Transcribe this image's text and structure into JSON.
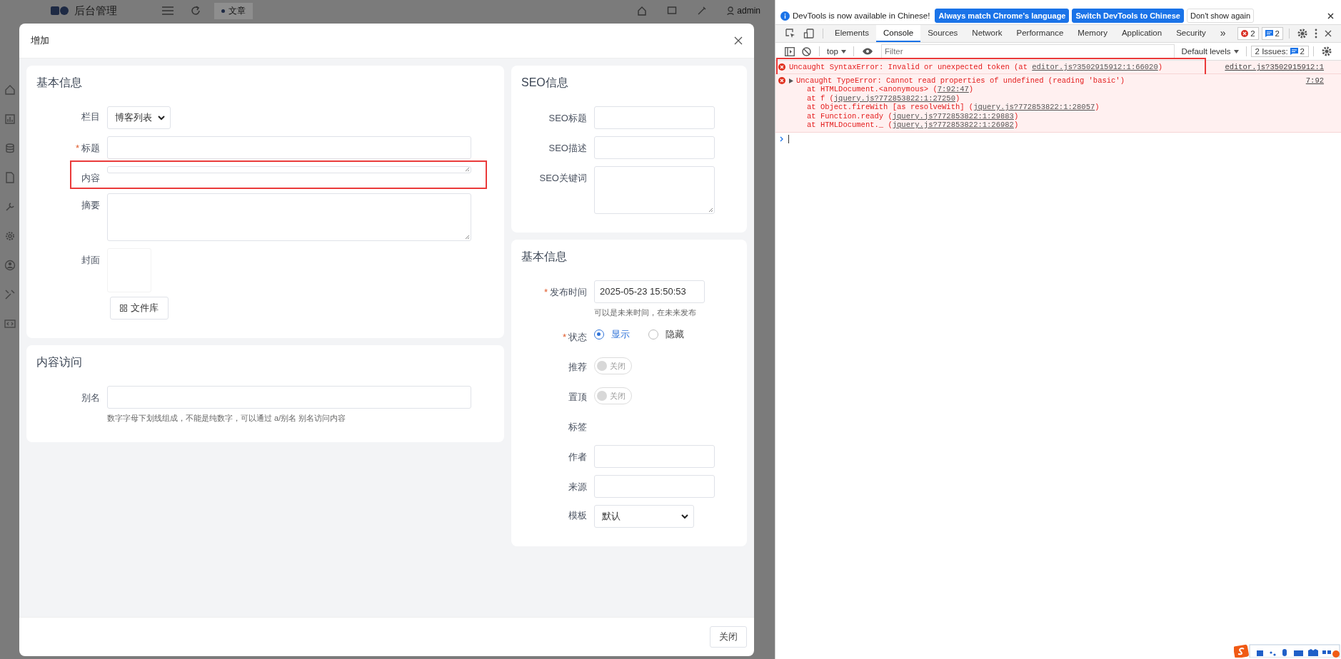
{
  "backdrop": {
    "app_title": "后台管理",
    "tab": "文章",
    "user": "admin"
  },
  "dialog": {
    "title": "增加",
    "footer_button": "关闭",
    "left_sections": [
      {
        "title": "基本信息",
        "fields": [
          {
            "kind": "select",
            "label": "栏目",
            "value": "博客列表"
          },
          {
            "kind": "text",
            "label": "标题",
            "required_mark": "*"
          },
          {
            "kind": "thin-textarea",
            "label": "内容",
            "highlighted": true
          },
          {
            "kind": "textarea",
            "label": "摘要"
          },
          {
            "kind": "cover",
            "label": "封面",
            "button": "文件库"
          }
        ]
      },
      {
        "title": "内容访问",
        "fields": [
          {
            "kind": "text",
            "label": "别名",
            "help": "数字字母下划线组成，不能是纯数字，可以通过 a/别名 别名访问内容"
          }
        ]
      }
    ],
    "right_sections": [
      {
        "title": "SEO信息",
        "fields": [
          {
            "kind": "text",
            "label": "SEO标题"
          },
          {
            "kind": "text",
            "label": "SEO描述"
          },
          {
            "kind": "textarea",
            "label": "SEO关键词"
          }
        ]
      },
      {
        "title": "基本信息",
        "fields": [
          {
            "kind": "date",
            "label": "发布时间",
            "required_mark": "*",
            "value": "2025-05-23 15:50:53",
            "help": "可以是未来时间，在未来发布"
          },
          {
            "kind": "radio",
            "label": "状态",
            "required_mark": "*",
            "options": [
              {
                "label": "显示",
                "selected": true
              },
              {
                "label": "隐藏",
                "selected": false
              }
            ]
          },
          {
            "kind": "switch",
            "label": "推荐",
            "on": false,
            "text": "关闭"
          },
          {
            "kind": "switch",
            "label": "置顶",
            "on": false,
            "text": "关闭"
          },
          {
            "kind": "none",
            "label": "标签"
          },
          {
            "kind": "text",
            "label": "作者"
          },
          {
            "kind": "text",
            "label": "来源"
          },
          {
            "kind": "select",
            "label": "模板",
            "value": "默认"
          }
        ]
      }
    ]
  },
  "devtools": {
    "infobar": {
      "message": "DevTools is now available in Chinese!",
      "buttons": [
        {
          "label": "Always match Chrome's language",
          "primary": true
        },
        {
          "label": "Switch DevTools to Chinese",
          "primary": true
        },
        {
          "label": "Don't show again",
          "primary": false
        }
      ]
    },
    "tabs": [
      {
        "label": "Elements",
        "selected": false
      },
      {
        "label": "Console",
        "selected": true
      },
      {
        "label": "Sources",
        "selected": false
      },
      {
        "label": "Network",
        "selected": false
      },
      {
        "label": "Performance",
        "selected": false
      },
      {
        "label": "Memory",
        "selected": false
      },
      {
        "label": "Application",
        "selected": false
      },
      {
        "label": "Security",
        "selected": false
      }
    ],
    "more_tabs": "»",
    "error_count": "2",
    "message_count": "2",
    "toolbar": {
      "context": "top",
      "filter_placeholder": "Filter",
      "levels": "Default levels",
      "issues_label": "2 Issues:",
      "issues_count": "2"
    },
    "messages": [
      {
        "kind": "error",
        "highlighted": true,
        "text": "Uncaught SyntaxError: Invalid or unexpected token (at ",
        "link": "editor.js?3502915912:1:66020",
        "suffix": ")",
        "source": "editor.js?3502915912:1"
      },
      {
        "kind": "error",
        "expandable": true,
        "text": "Uncaught TypeError: Cannot read properties of undefined (reading 'basic')",
        "source": "7:92",
        "stack": [
          {
            "text": "at HTMLDocument.<anonymous> (",
            "link": "7:92:47",
            "suffix": ")"
          },
          {
            "text": "at f (",
            "link": "jquery.js?772853822:1:27250",
            "suffix": ")"
          },
          {
            "text": "at Object.fireWith [as resolveWith] (",
            "link": "jquery.js?772853822:1:28057",
            "suffix": ")"
          },
          {
            "text": "at Function.ready (",
            "link": "jquery.js?772853822:1:29883",
            "suffix": ")"
          },
          {
            "text": "at HTMLDocument._ (",
            "link": "jquery.js?772853822:1:26982",
            "suffix": ")"
          }
        ]
      }
    ]
  }
}
